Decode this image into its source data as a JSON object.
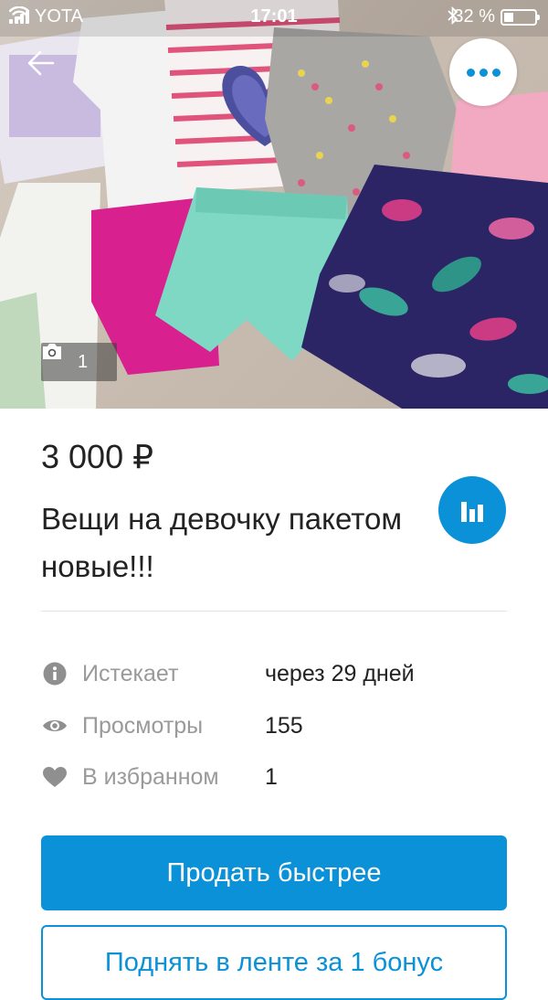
{
  "status_bar": {
    "carrier": "YOTA",
    "time": "17:01",
    "battery_percent": "32 %",
    "battery_level": 0.32
  },
  "header": {
    "back_icon": "arrow-left-icon",
    "more_icon": "more-horizontal-icon"
  },
  "photo": {
    "count": "1",
    "camera_icon": "camera-icon"
  },
  "listing": {
    "price": "3 000 ₽",
    "title": "Вещи на девочку пакетом новые!!!"
  },
  "info": [
    {
      "icon": "info-icon",
      "label": "Истекает",
      "value": "через 29 дней"
    },
    {
      "icon": "eye-icon",
      "label": "Просмотры",
      "value": "155"
    },
    {
      "icon": "heart-icon",
      "label": "В избранном",
      "value": "1"
    }
  ],
  "actions": {
    "primary": "Продать быстрее",
    "secondary": "Поднять в ленте за 1 бонус"
  },
  "colors": {
    "accent": "#0a91d8",
    "muted_text": "#9a9a9a",
    "icon_gray": "#8f8f8f"
  }
}
